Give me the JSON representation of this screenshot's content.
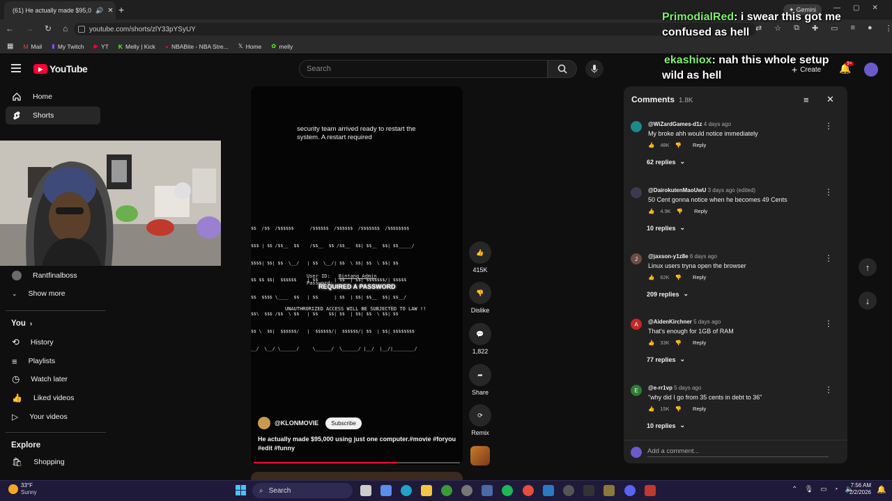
{
  "browser": {
    "tab_title": "(61) He actually made $95,0",
    "url": "youtube.com/shorts/zlY33pYSyUY",
    "bookmarks": [
      {
        "label": "Mail",
        "icon": "mail-icon"
      },
      {
        "label": "My Twitch",
        "icon": "twitch-icon"
      },
      {
        "label": "YT",
        "icon": "youtube-icon"
      },
      {
        "label": "Melly | Kick",
        "icon": "kick-icon"
      },
      {
        "label": "NBABite - NBA Stre...",
        "icon": "nba-icon"
      },
      {
        "label": "Home",
        "icon": "x-icon"
      },
      {
        "label": "melly",
        "icon": "melly-icon"
      }
    ],
    "gemini_label": "Gemini"
  },
  "header": {
    "logo_text": "YouTube",
    "search_placeholder": "Search",
    "create_label": "Create",
    "notifications_badge": "9+"
  },
  "sidebar": {
    "top_items": [
      {
        "label": "Home",
        "icon": "home-icon"
      },
      {
        "label": "Shorts",
        "icon": "shorts-icon",
        "active": true
      }
    ],
    "subscription": "Rantfinalboss",
    "show_more": "Show more",
    "you_heading": "You",
    "you_items": [
      {
        "label": "History",
        "icon": "history-icon"
      },
      {
        "label": "Playlists",
        "icon": "playlists-icon"
      },
      {
        "label": "Watch later",
        "icon": "clock-icon"
      },
      {
        "label": "Liked videos",
        "icon": "thumbs-up-icon"
      },
      {
        "label": "Your videos",
        "icon": "video-icon"
      }
    ],
    "explore_heading": "Explore",
    "explore_items": [
      {
        "label": "Shopping",
        "icon": "shopping-bag-icon"
      }
    ]
  },
  "video": {
    "caption": "security team arrived ready to restart the system. A restart required",
    "ascii_lines": [
      "$$  /$$  /$$$$$$      /$$$$$$  /$$$$$$  /$$$$$$$  /$$$$$$$$",
      "$$$ | $$ /$$__  $$    /$$__  $$ /$$__  $$| $$__  $$| $$_____/",
      "$$$$| $$| $$  \\__/   | $$  \\__/| $$  \\ $$| $$  \\ $$| $$",
      "$$ $$ $$|  $$$$$$    | $$      | $$  | $$| $$$$$$$/| $$$$$",
      "$$  $$$$ \\____  $$   | $$      | $$  | $$| $$__  $$| $$__/",
      "$$\\  $$$ /$$  \\ $$   | $$    $$| $$  | $$| $$  \\ $$| $$",
      "$$ \\  $$|  $$$$$$/   |  $$$$$$/|  $$$$$$/| $$  | $$| $$$$$$$$",
      "__/  \\__/ \\______/     \\______/  \\______/ |__/  |__/|________/"
    ],
    "userid_label": "User ID:",
    "userid_value": "Bintang  Admin",
    "password_label": "Password:",
    "required_password": "REQUIRED A PASSWORD",
    "unauthorized": "UNAUTHRORIZED ACCESS WILL BE SUBJECTED TO LAW !!",
    "channel": "@KLONMOVIE",
    "subscribe_label": "Subscribe",
    "title": "He actually made $95,000 using just one computer.#movie #foryou #edit #funny",
    "progress": 0.7
  },
  "actions": {
    "likes": "415K",
    "dislike_label": "Dislike",
    "comments_count": "1,822",
    "share_label": "Share",
    "remix_label": "Remix"
  },
  "comments_panel": {
    "title": "Comments",
    "count": "1.8K",
    "add_placeholder": "Add a comment...",
    "items": [
      {
        "user": "@WiZardGames-d1z",
        "time": "4 days ago",
        "text": "My broke ahh would notice immediately",
        "likes": "48K",
        "replies": "62 replies",
        "avatar": "",
        "avatar_color": "#1a8a8a"
      },
      {
        "user": "@DairokutenMaoUwU",
        "time": "3 days ago (edited)",
        "text": "50 Cent gonna notice when he becomes 49 Cents",
        "likes": "4.9K",
        "replies": "10 replies",
        "avatar": "",
        "avatar_color": "#3b3b4f"
      },
      {
        "user": "@jaxson-y1z8e",
        "time": "6 days ago",
        "text": "Linux users tryna open the browser",
        "likes": "62K",
        "replies": "209 replies",
        "avatar": "J",
        "avatar_color": "#6d4c41"
      },
      {
        "user": "@AidenKirchner",
        "time": "5 days ago",
        "text": "That's enough for 1GB of RAM",
        "likes": "33K",
        "replies": "77 replies",
        "avatar": "A",
        "avatar_color": "#c62828"
      },
      {
        "user": "@e-rr1vp",
        "time": "5 days ago",
        "text": "\"why did I go from 35 cents in debt to 36\"",
        "likes": "15K",
        "replies": "10 replies",
        "avatar": "E",
        "avatar_color": "#2e7d32"
      }
    ],
    "reply_label": "Reply"
  },
  "chat_overlay": [
    {
      "name": "PrimodialRed",
      "message": ": i swear this got me confused as hell"
    },
    {
      "name": "ekashiox",
      "message": ": nah this whole setup wild as hell"
    }
  ],
  "taskbar": {
    "weather_temp": "33°F",
    "weather_desc": "Sunny",
    "search_label": "Search",
    "time": "7:56 AM",
    "date": "2/2/2026"
  }
}
